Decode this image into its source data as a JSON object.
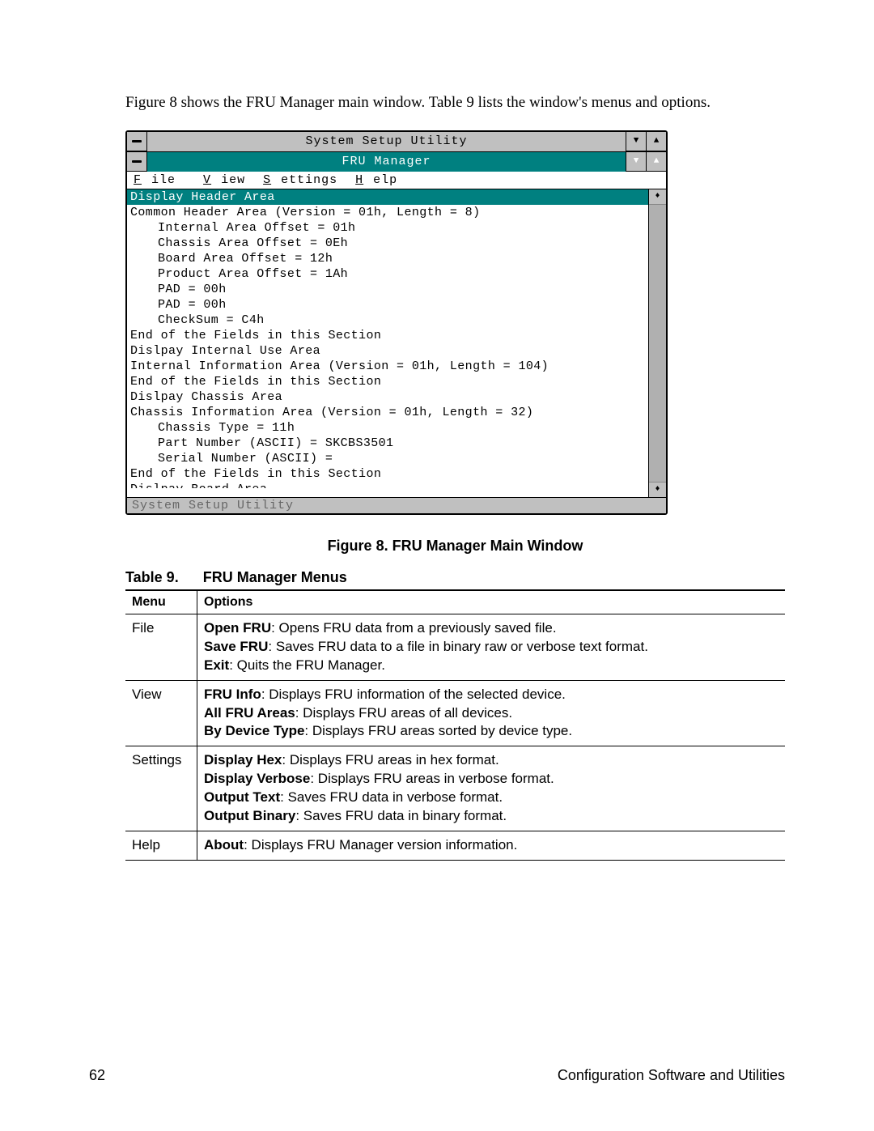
{
  "intro_text": "Figure 8 shows the FRU Manager main window.  Table 9 lists the window's menus and options.",
  "window": {
    "outer_title": "System Setup Utility",
    "inner_title": "FRU Manager",
    "menubar": {
      "file": "File",
      "view": "View",
      "settings": "Settings",
      "help": "Help"
    },
    "highlighted_line": "Display Header Area",
    "lines": {
      "l0": "Common Header Area (Version = 01h, Length = 8)",
      "l1": "Internal Area Offset = 01h",
      "l2": "Chassis Area Offset = 0Eh",
      "l3": "Board Area Offset = 12h",
      "l4": "Product Area Offset = 1Ah",
      "l5": "PAD = 00h",
      "l6": "PAD = 00h",
      "l7": "CheckSum = C4h",
      "l8": "End of the Fields in this Section",
      "l9": "Dislpay Internal Use Area",
      "l10": "Internal Information Area (Version = 01h, Length = 104)",
      "l11": "End of the Fields in this Section",
      "l12": "Dislpay Chassis Area",
      "l13": "Chassis Information Area (Version = 01h, Length = 32)",
      "l14": "Chassis Type = 11h",
      "l15": "Part Number (ASCII) = SKCBS3501",
      "l16": "Serial Number (ASCII) =",
      "l17": "End of the Fields in this Section",
      "l18": "Dislpay Board Area"
    },
    "statusbar": "System Setup Utility"
  },
  "figure_caption": "Figure 8.  FRU Manager Main Window",
  "table": {
    "title_prefix": "Table 9.",
    "title_main": "FRU Manager Menus",
    "headers": {
      "menu": "Menu",
      "options": "Options"
    },
    "rows": {
      "file": {
        "menu": "File",
        "opts": {
          "o1b": "Open FRU",
          "o1t": ":  Opens FRU data from a previously saved file.",
          "o2b": "Save FRU",
          "o2t": ":  Saves FRU data to a file in binary raw or verbose text format.",
          "o3b": "Exit",
          "o3t": ":  Quits the FRU Manager."
        }
      },
      "view": {
        "menu": "View",
        "opts": {
          "o1b": "FRU Info",
          "o1t": ":  Displays FRU information of the selected device.",
          "o2b": "All FRU Areas",
          "o2t": ":  Displays FRU areas of all devices.",
          "o3b": "By Device Type",
          "o3t": ":  Displays FRU areas sorted by device type."
        }
      },
      "settings": {
        "menu": "Settings",
        "opts": {
          "o1b": "Display Hex",
          "o1t": ":  Displays FRU areas in hex format.",
          "o2b": "Display Verbose",
          "o2t": ":  Displays FRU areas in verbose format.",
          "o3b": "Output Text",
          "o3t": ":  Saves FRU data in verbose format.",
          "o4b": "Output Binary",
          "o4t": ":  Saves FRU data in binary format."
        }
      },
      "help": {
        "menu": "Help",
        "opts": {
          "o1b": "About",
          "o1t": ":  Displays FRU Manager version information."
        }
      }
    }
  },
  "footer": {
    "page_num": "62",
    "doc_title": "Configuration Software and Utilities"
  }
}
